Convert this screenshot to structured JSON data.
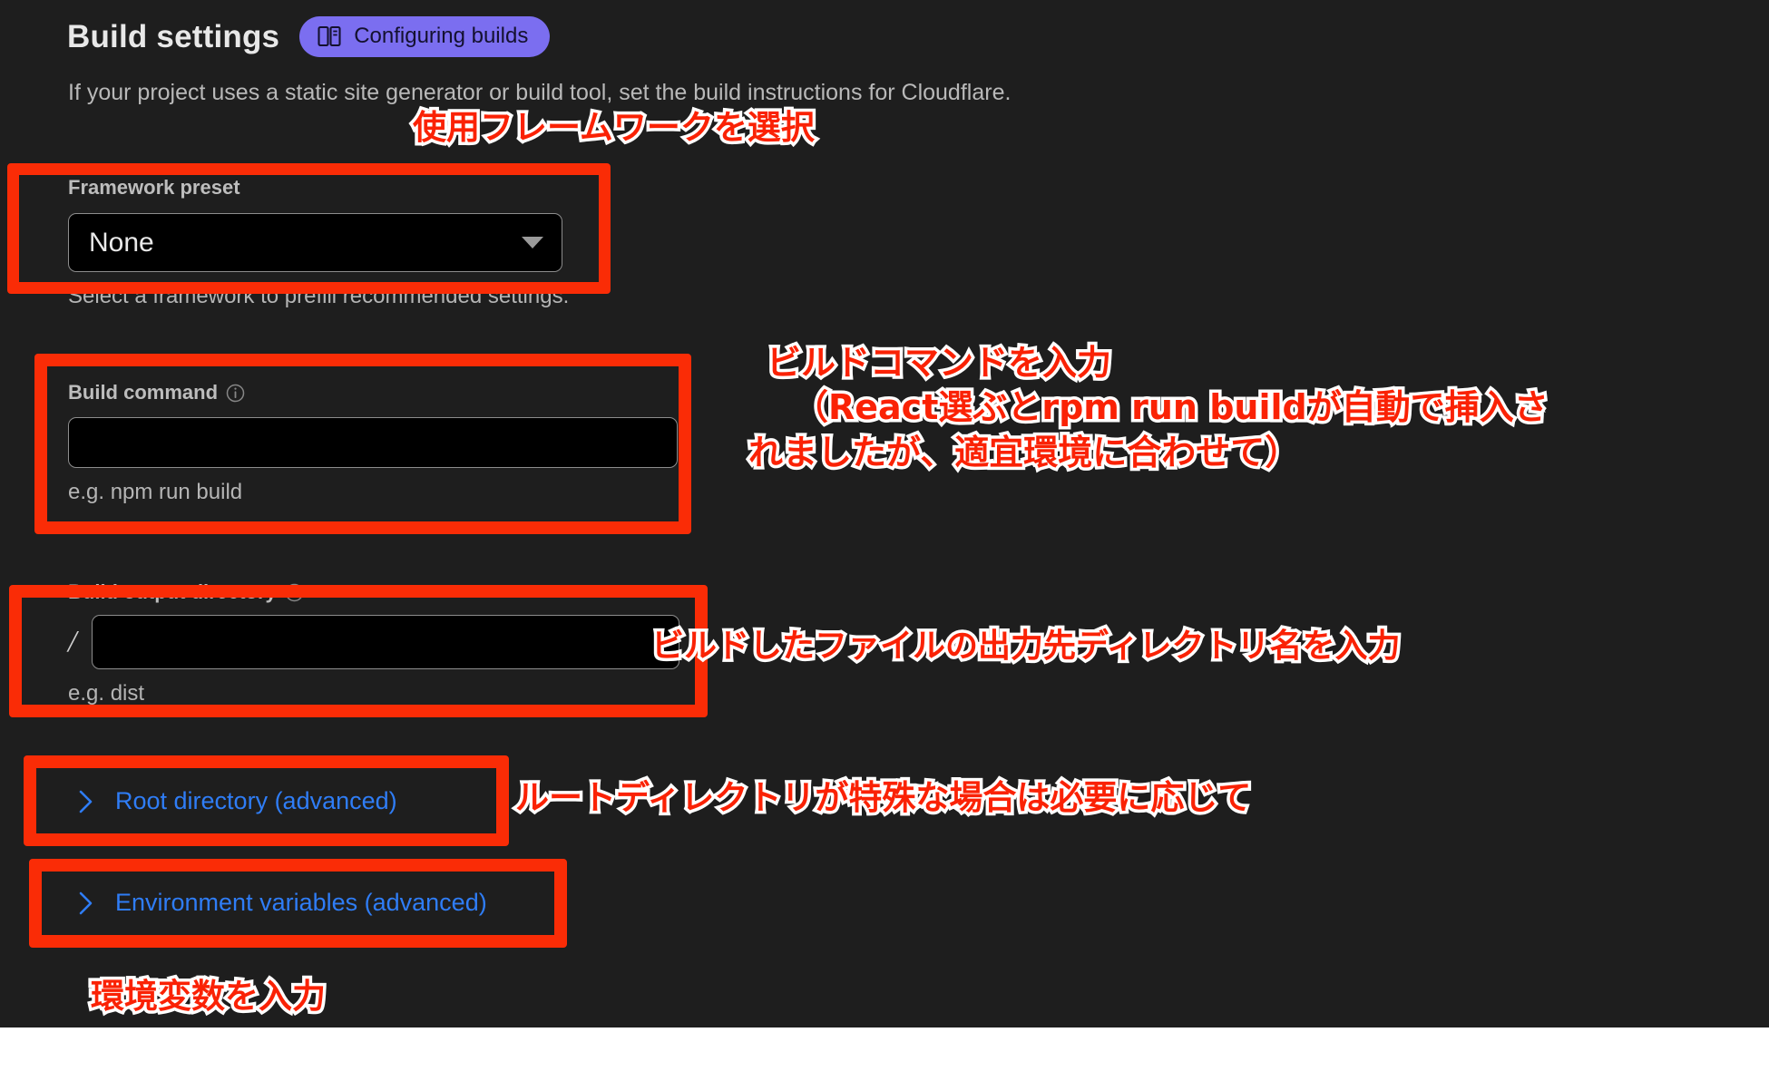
{
  "page": {
    "title": "Build settings",
    "description": "If your project uses a static site generator or build tool, set the build instructions for Cloudflare.",
    "badge": {
      "label": "Configuring builds",
      "icon": "book-icon",
      "background": "#7b6ef0",
      "text_color": "#14112f"
    },
    "background": "#1e1e1e"
  },
  "fields": {
    "framework_preset": {
      "label": "Framework preset",
      "value": "None",
      "helper": "Select a framework to prefill recommended settings.",
      "dropdown_icon": "chevron-down-icon"
    },
    "build_command": {
      "label": "Build command",
      "info_icon": "info-circle-icon",
      "value": "",
      "placeholder": "",
      "helper": "e.g. npm run build"
    },
    "build_output_directory": {
      "label": "Build output directory",
      "info_icon": "info-circle-icon",
      "prefix": "/",
      "value": "",
      "placeholder": "",
      "helper": "e.g. dist"
    }
  },
  "disclosures": [
    {
      "label": "Root directory (advanced)",
      "icon": "chevron-right-icon",
      "color": "#2f7df6"
    },
    {
      "label": "Environment variables (advanced)",
      "icon": "chevron-right-icon",
      "color": "#2f7df6"
    }
  ],
  "annotations": {
    "color": "#fa2205",
    "outline_color": "#ffffff",
    "box_color": "#fa2c06",
    "framework": "使用フレームワークを選択",
    "build_command_line1": "ビルドコマンドを入力",
    "build_command_line2": "（React選ぶとrpm run buildが自動で挿入さ",
    "build_command_line3": "れましたが、適宜環境に合わせて）",
    "output_directory": "ビルドしたファイルの出力先ディレクトリ名を入力",
    "root_directory": "ルートディレクトリが特殊な場合は必要に応じて",
    "environment_variables": "環境変数を入力"
  }
}
